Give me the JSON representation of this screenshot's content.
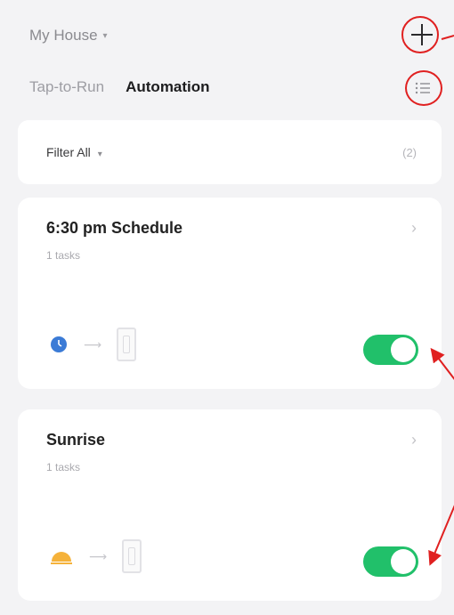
{
  "header": {
    "home_name": "My House",
    "home_caret": "▾",
    "tabs": [
      {
        "label": "Tap-to-Run",
        "active": false
      },
      {
        "label": "Automation",
        "active": true
      }
    ]
  },
  "filter": {
    "label": "Filter All",
    "caret": "▾",
    "count": "(2)"
  },
  "automations": [
    {
      "title": "6:30 pm Schedule",
      "subtitle": "1 tasks",
      "trigger_icon": "clock-icon",
      "enabled": true
    },
    {
      "title": "Sunrise",
      "subtitle": "1 tasks",
      "trigger_icon": "sunrise-icon",
      "enabled": true
    }
  ],
  "arrow_glyph": "⟶",
  "chevron_glyph": "›",
  "colors": {
    "toggle_on": "#21c06a",
    "annotation_red": "#e02020",
    "clock_blue": "#3b7bd6",
    "sun_orange": "#f5b23a",
    "background": "#f3f3f5"
  }
}
